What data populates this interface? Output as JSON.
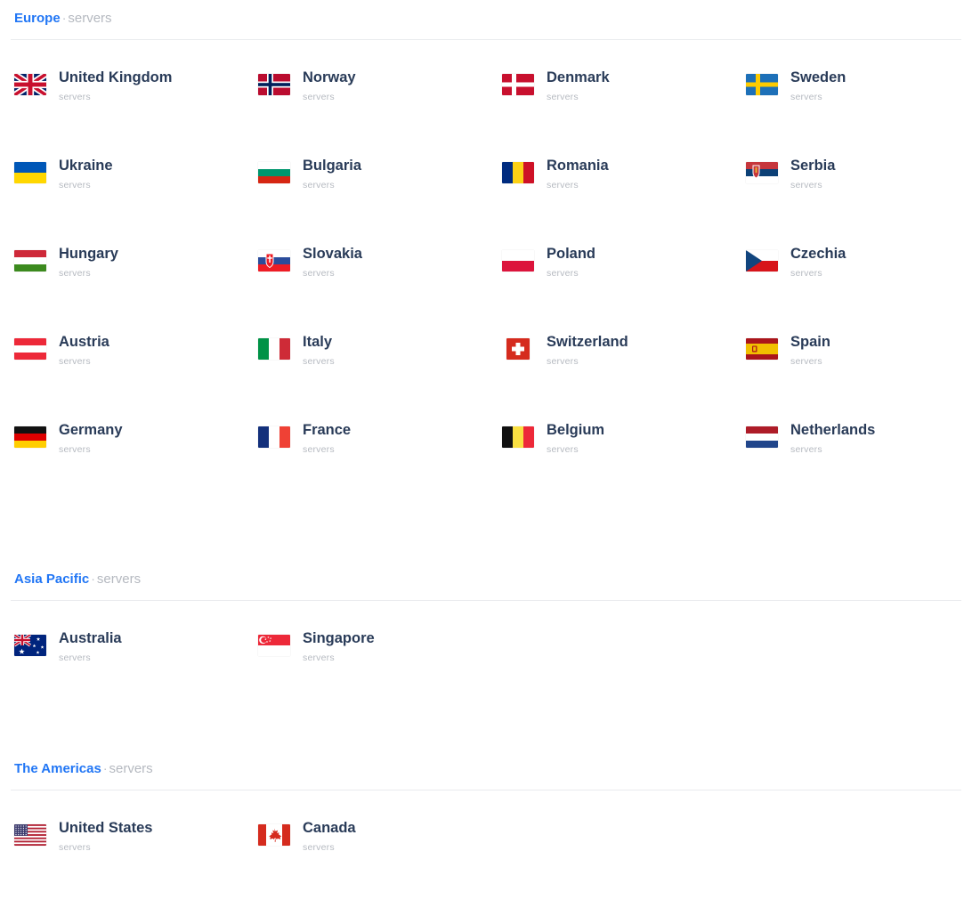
{
  "accent_color": "#2176f5",
  "name_color": "#293b58",
  "sub_color": "#b6bac1",
  "separator": "·",
  "sections": [
    {
      "id": "europe",
      "title": "Europe",
      "subtitle": "servers",
      "countries": [
        {
          "name": "United Kingdom",
          "sub": "servers",
          "flag": "flag-united-kingdom"
        },
        {
          "name": "Norway",
          "sub": "servers",
          "flag": "flag-norway"
        },
        {
          "name": "Denmark",
          "sub": "servers",
          "flag": "flag-denmark"
        },
        {
          "name": "Sweden",
          "sub": "servers",
          "flag": "flag-sweden"
        },
        {
          "name": "Ukraine",
          "sub": "servers",
          "flag": "flag-ukraine"
        },
        {
          "name": "Bulgaria",
          "sub": "servers",
          "flag": "flag-bulgaria"
        },
        {
          "name": "Romania",
          "sub": "servers",
          "flag": "flag-romania"
        },
        {
          "name": "Serbia",
          "sub": "servers",
          "flag": "flag-serbia"
        },
        {
          "name": "Hungary",
          "sub": "servers",
          "flag": "flag-hungary"
        },
        {
          "name": "Slovakia",
          "sub": "servers",
          "flag": "flag-slovakia"
        },
        {
          "name": "Poland",
          "sub": "servers",
          "flag": "flag-poland"
        },
        {
          "name": "Czechia",
          "sub": "servers",
          "flag": "flag-czechia"
        },
        {
          "name": "Austria",
          "sub": "servers",
          "flag": "flag-austria"
        },
        {
          "name": "Italy",
          "sub": "servers",
          "flag": "flag-italy"
        },
        {
          "name": "Switzerland",
          "sub": "servers",
          "flag": "flag-switzerland"
        },
        {
          "name": "Spain",
          "sub": "servers",
          "flag": "flag-spain"
        },
        {
          "name": "Germany",
          "sub": "servers",
          "flag": "flag-germany"
        },
        {
          "name": "France",
          "sub": "servers",
          "flag": "flag-france"
        },
        {
          "name": "Belgium",
          "sub": "servers",
          "flag": "flag-belgium"
        },
        {
          "name": "Netherlands",
          "sub": "servers",
          "flag": "flag-netherlands"
        }
      ]
    },
    {
      "id": "asia-pacific",
      "title": "Asia Pacific",
      "subtitle": "servers",
      "countries": [
        {
          "name": "Australia",
          "sub": "servers",
          "flag": "flag-australia"
        },
        {
          "name": "Singapore",
          "sub": "servers",
          "flag": "flag-singapore"
        }
      ]
    },
    {
      "id": "the-americas",
      "title": "The Americas",
      "subtitle": "servers",
      "countries": [
        {
          "name": "United States",
          "sub": "servers",
          "flag": "flag-united-states"
        },
        {
          "name": "Canada",
          "sub": "servers",
          "flag": "flag-canada"
        }
      ]
    }
  ]
}
